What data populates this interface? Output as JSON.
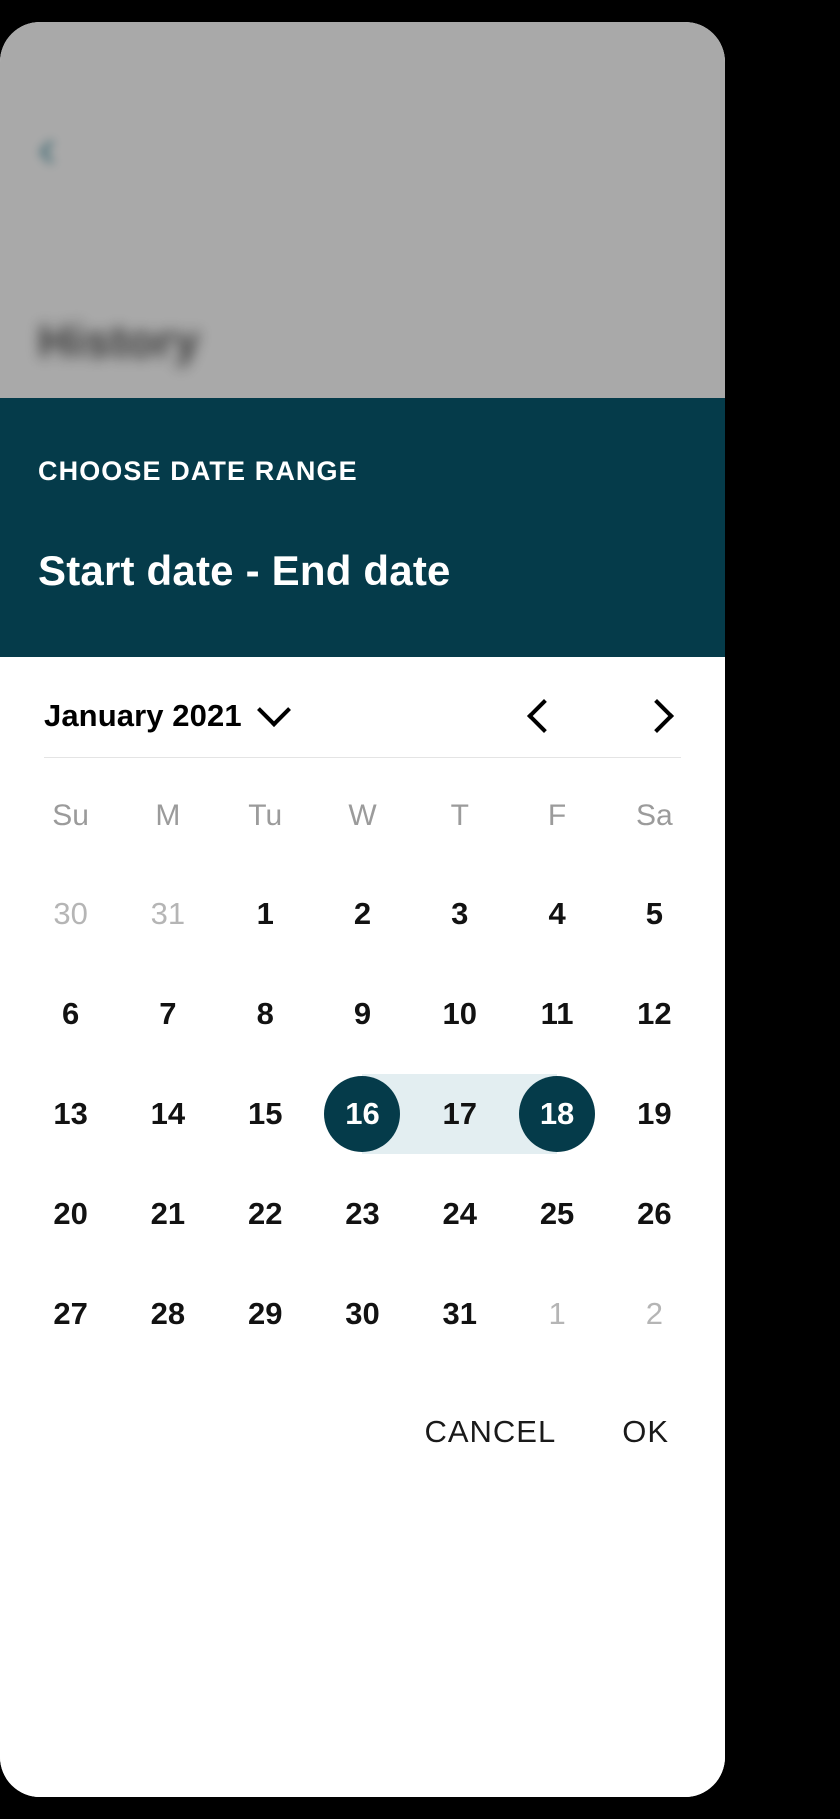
{
  "backdrop": {
    "back_icon": "‹",
    "title": "History"
  },
  "dialog": {
    "overline": "CHOOSE DATE RANGE",
    "title": "Start date - End date",
    "header_bg": "#053b4a"
  },
  "month_bar": {
    "month_label": "January 2021",
    "dropdown_icon": "chevron-down-icon",
    "prev_icon": "chevron-left-icon",
    "next_icon": "chevron-right-icon"
  },
  "calendar": {
    "weekdays": [
      "Su",
      "M",
      "Tu",
      "W",
      "T",
      "F",
      "Sa"
    ],
    "selection": {
      "start": 16,
      "end": 18,
      "accent": "#053b4a",
      "range_fill": "#e3eef1"
    },
    "weeks": [
      [
        {
          "label": "30",
          "state": "muted"
        },
        {
          "label": "31",
          "state": "muted"
        },
        {
          "label": "1",
          "state": "normal"
        },
        {
          "label": "2",
          "state": "normal"
        },
        {
          "label": "3",
          "state": "normal"
        },
        {
          "label": "4",
          "state": "normal"
        },
        {
          "label": "5",
          "state": "normal"
        }
      ],
      [
        {
          "label": "6",
          "state": "normal"
        },
        {
          "label": "7",
          "state": "normal"
        },
        {
          "label": "8",
          "state": "normal"
        },
        {
          "label": "9",
          "state": "normal"
        },
        {
          "label": "10",
          "state": "normal"
        },
        {
          "label": "11",
          "state": "normal"
        },
        {
          "label": "12",
          "state": "normal"
        }
      ],
      [
        {
          "label": "13",
          "state": "normal"
        },
        {
          "label": "14",
          "state": "normal"
        },
        {
          "label": "15",
          "state": "normal"
        },
        {
          "label": "16",
          "state": "selected-start"
        },
        {
          "label": "17",
          "state": "in-range"
        },
        {
          "label": "18",
          "state": "selected-end"
        },
        {
          "label": "19",
          "state": "normal"
        }
      ],
      [
        {
          "label": "20",
          "state": "normal"
        },
        {
          "label": "21",
          "state": "normal"
        },
        {
          "label": "22",
          "state": "normal"
        },
        {
          "label": "23",
          "state": "normal"
        },
        {
          "label": "24",
          "state": "normal"
        },
        {
          "label": "25",
          "state": "normal"
        },
        {
          "label": "26",
          "state": "normal"
        }
      ],
      [
        {
          "label": "27",
          "state": "normal"
        },
        {
          "label": "28",
          "state": "normal"
        },
        {
          "label": "29",
          "state": "normal"
        },
        {
          "label": "30",
          "state": "normal"
        },
        {
          "label": "31",
          "state": "normal"
        },
        {
          "label": "1",
          "state": "muted"
        },
        {
          "label": "2",
          "state": "muted"
        }
      ]
    ]
  },
  "footer": {
    "cancel_label": "CANCEL",
    "ok_label": "OK"
  }
}
